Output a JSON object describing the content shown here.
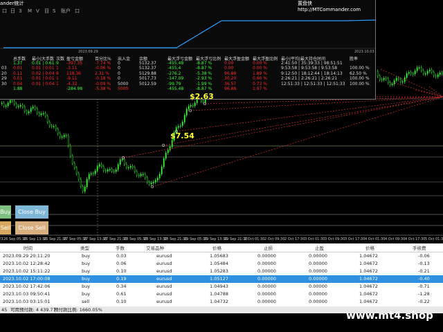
{
  "window": {
    "title_fragment": "ander统计",
    "website_label": "置盘侠 http://MTCommander.com"
  },
  "menu": [
    {
      "label": "口"
    },
    {
      "label": "日"
    },
    {
      "label": "3"
    },
    {
      "label": "M"
    },
    {
      "label": "V"
    },
    {
      "label": "目"
    },
    {
      "label": "S"
    },
    {
      "label": "账户"
    },
    {
      "label": "口"
    }
  ],
  "equity_chart": {
    "start_label": "2023.09.29",
    "end_label": "2023.10.03"
  },
  "stats_table": {
    "headers": [
      "总手数",
      "最小|大手数",
      "次数",
      "盈亏金额",
      "百分比%",
      "出入金",
      "余额",
      "最大浮亏金额",
      "最大浮亏比例",
      "最大浮盈金额",
      "最大浮盈比例",
      "最小|平均|最大持仓时间",
      "胜率"
    ],
    "rows": [
      {
        "id": "",
        "lots": "1.37",
        "minmax": "0.01 | 0.61",
        "count": "9",
        "pnl": "-397.35",
        "pct": "-7.74 %",
        "flow": "0",
        "balance": "5132.37",
        "maxloss": "-455.48",
        "maxlosspct": "-8.87 %",
        "maxprofit": "0.00",
        "maxprofitpct": "0.00 %",
        "hold": "2:41:50 | 35:39:33 | 98:51:51",
        "win": ""
      },
      {
        "id": "03",
        "lots": "0.01",
        "minmax": "0.01 | 0.01",
        "count": "1",
        "pnl": "-3.11",
        "pct": "-0.06 %",
        "flow": "0",
        "balance": "5132.37",
        "maxloss": "-455.4",
        "maxlosspct": "-8.87 %",
        "maxprofit": "0.00",
        "maxprofitpct": "0.00 %",
        "hold": "9:53:58 | 9:53:58 | 9:53:58",
        "win": "100.00 %"
      },
      {
        "id": "20",
        "lots": "0.11",
        "minmax": "0.02 | 0.04",
        "count": "8",
        "pnl": "118.36",
        "pct": "2.31 %",
        "flow": "0",
        "balance": "5129.88",
        "maxloss": "-276.2",
        "maxlosspct": "-5.38 %",
        "maxprofit": "96.88",
        "maxprofitpct": "1.89 %",
        "hold": "9:12:50 | 18:12:44 | 18:14:13",
        "win": "62.50 %"
      },
      {
        "id": "29",
        "lots": "0.01",
        "minmax": "0.01 | 0.01",
        "count": "1",
        "pnl": "-9.11",
        "pct": "-0.18 %",
        "flow": "0",
        "balance": "5017.73",
        "maxloss": "-147.09",
        "maxlosspct": "-2.93 %",
        "maxprofit": "30.20",
        "maxprofitpct": "0.60 %",
        "hold": "2:26:21 | 2:26:21 | 2:26:21",
        "win": "100.00 %"
      },
      {
        "id": "30",
        "lots": "0.04",
        "minmax": "0.01 | 0.04",
        "count": "1",
        "pnl": "-4.32",
        "pct": "-0.09 %",
        "flow": "5000",
        "balance": "5012.59",
        "maxloss": "-99.79",
        "maxlosspct": "-1.99 %",
        "maxprofit": "36.57",
        "maxprofitpct": "0.73 %",
        "hold": "12:51:33 | 12:51:33 | 12:51:33",
        "win": "100.00 %"
      }
    ],
    "total": {
      "lots": "1.88",
      "pnl": "-284.98",
      "pct": "-5.38 %",
      "flow": "5000",
      "maxloss": "-455.48",
      "maxlosspct": "-8.87 %",
      "maxprofit": "96.88",
      "maxprofitpct": "1.97 %"
    }
  },
  "chart": {
    "price_labels": [
      "$2.63",
      "$7.54"
    ],
    "buttons": [
      {
        "label": "Buy",
        "color": "#7fbf7f"
      },
      {
        "label": "Close Buy",
        "color": "#7fb7d8"
      },
      {
        "label": "Sell",
        "color": "#d8a860"
      },
      {
        "label": "Close Sell",
        "color": "#d8b080"
      }
    ],
    "time_axis": [
      "6 Sep 2023",
      "26 Sep 05:30",
      "26 Sep 13:30",
      "26 Sep 21:30",
      "27 Sep 05:30",
      "27 Sep 13:30",
      "27 Sep 21:30",
      "28 Sep 05:30",
      "28 Sep 13:30",
      "28 Sep 21:30",
      "29 Sep 05:30",
      "29 Sep 13:30",
      "29 Sep 21:30",
      "2 Oct 01:30",
      "2 Oct 09:30",
      "2 Oct 17:30",
      "3 Oct 01:30",
      "3 Oct 09:30",
      "3 Oct 17:30",
      "4 Oct 01:30",
      "4 Oct 09:30",
      "4 Oct 17:30",
      "5 Oct 01:30",
      "5 Oct 09:30",
      "5 Oct 17:30",
      "6 Oct"
    ]
  },
  "orders": {
    "headers": [
      "时间",
      "类型",
      "手数",
      "交易品种",
      "价格",
      "止损",
      "止盈",
      "价格",
      "手续费"
    ],
    "rows": [
      {
        "time": "2023.09.29 20:11:20",
        "type": "buy",
        "lots": "0.03",
        "symbol": "eurusd",
        "price": "1.05683",
        "sl": "0.00000",
        "tp": "0.00000",
        "cur": "1.04672",
        "fee": "-0.06",
        "selected": false
      },
      {
        "time": "2023.10.02 12:28:42",
        "type": "buy",
        "lots": "0.06",
        "symbol": "eurusd",
        "price": "1.05484",
        "sl": "0.00000",
        "tp": "0.00000",
        "cur": "1.04672",
        "fee": "-0.13",
        "selected": false
      },
      {
        "time": "2023.10.02 15:11:22",
        "type": "buy",
        "lots": "0.10",
        "symbol": "eurusd",
        "price": "1.05283",
        "sl": "0.00000",
        "tp": "0.00000",
        "cur": "1.04672",
        "fee": "-0.21",
        "selected": false
      },
      {
        "time": "2023.10.02 17:00:08",
        "type": "buy",
        "lots": "0.19",
        "symbol": "eurusd",
        "price": "1.05127",
        "sl": "0.00000",
        "tp": "0.00000",
        "cur": "1.04672",
        "fee": "-0.40",
        "selected": true
      },
      {
        "time": "2023.10.02 17:42:06",
        "type": "buy",
        "lots": "0.34",
        "symbol": "eurusd",
        "price": "1.04943",
        "sl": "0.00000",
        "tp": "0.00000",
        "cur": "1.04672",
        "fee": "-0.71",
        "selected": false
      },
      {
        "time": "2023.10.03 09:50:41",
        "type": "buy",
        "lots": "0.61",
        "symbol": "eurusd",
        "price": "1.04788",
        "sl": "0.00000",
        "tp": "0.00000",
        "cur": "1.04672",
        "fee": "-1.28",
        "selected": false
      },
      {
        "time": "2023.10.03 03:15:01",
        "type": "sell",
        "lots": "0.10",
        "symbol": "eurusd",
        "price": "1.04732",
        "sl": "0.00000",
        "tp": "0.00000",
        "cur": "1.04672",
        "fee": "-0.22",
        "selected": false
      }
    ]
  },
  "footer": {
    "balance_frag": "45",
    "margin_label": "可用预付款: 4 439.77",
    "ratio_label": "预付款比例: 1660.05%"
  },
  "watermark": "www.mt4.shop"
}
